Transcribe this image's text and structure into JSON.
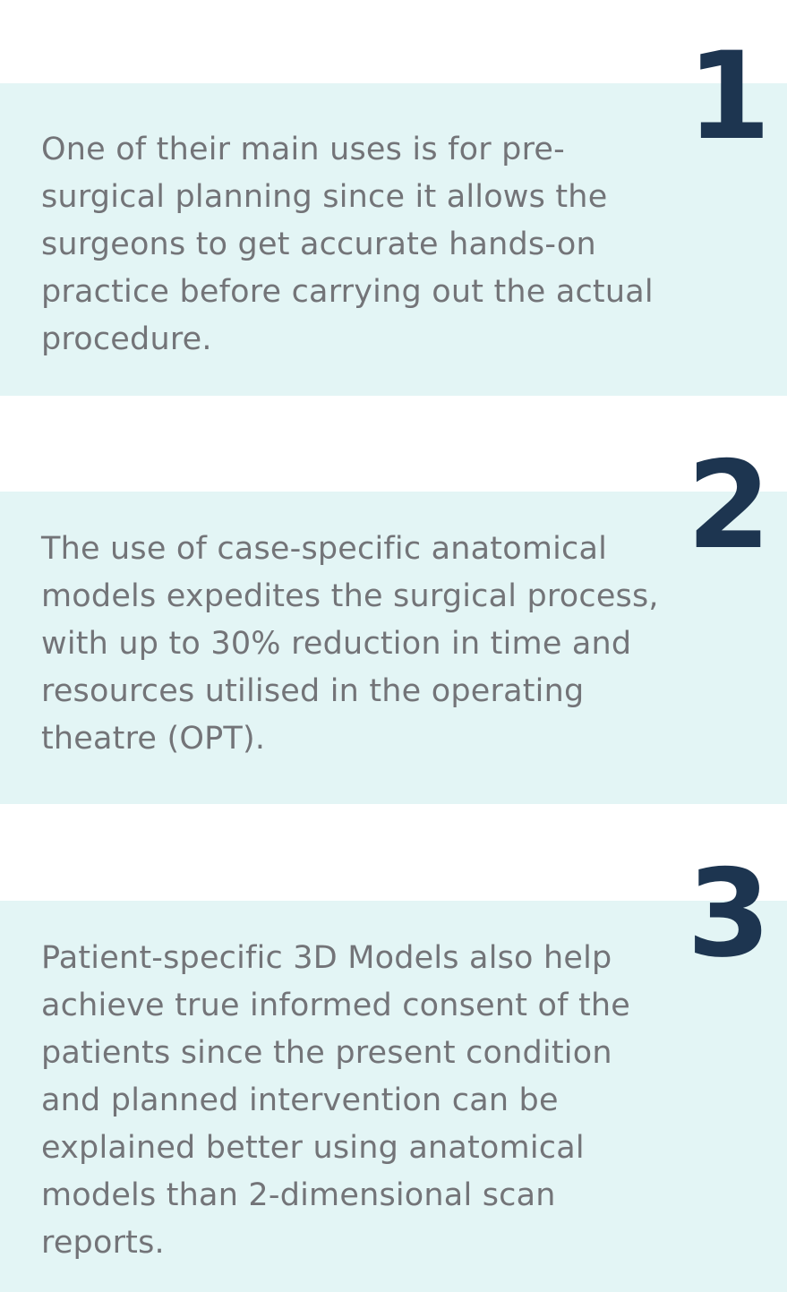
{
  "items": [
    {
      "number": "1",
      "text": "One of their main uses is for pre-\nsurgical planning since it allows the\nsurgeons to get accurate hands-on\npractice before carrying out the actual\nprocedure."
    },
    {
      "number": "2",
      "text": "The use of case-specific anatomical\nmodels expedites the surgical process,\nwith up to 30% reduction in time and\nresources utilised in the operating\ntheatre (OPT)."
    },
    {
      "number": "3",
      "text": "Patient-specific 3D Models also help\nachieve true informed consent of the\npatients since the present condition\nand planned intervention can be\nexplained better using anatomical\nmodels than 2-dimensional scan\nreports."
    }
  ],
  "colors": {
    "card_background": "#e3f5f5",
    "number": "#1d3550",
    "text": "#737478"
  }
}
